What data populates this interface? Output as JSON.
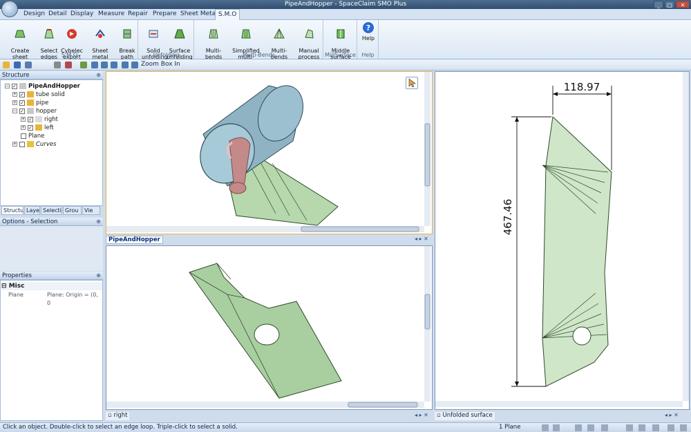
{
  "window": {
    "title": "PipeAndHopper - SpaceClaim SMO Plus",
    "minimize": "_",
    "maximize": "□",
    "close": "✕"
  },
  "tabs": [
    "Design",
    "Detail",
    "Display",
    "Measure",
    "Repair",
    "Prepare",
    "Sheet Metal",
    "S.M.O"
  ],
  "ribbon": {
    "groups": [
      {
        "label": "S.M.O",
        "buttons": [
          "Create sheet\nmetal profil",
          "Select\nedges",
          "Cybelec\nexport",
          "Sheet metal\nrebuild",
          "Break\npath"
        ]
      },
      {
        "label": "Unfolding",
        "buttons": [
          "Solid\nunfolding",
          "Surface\nunfolding"
        ]
      },
      {
        "label": "Multi-Bends",
        "buttons": [
          "Multi-bends",
          "Simplified\nmulti-bends",
          "Multi-bends\ncone",
          "Manual\nprocess"
        ]
      },
      {
        "label": "MidSurface",
        "buttons": [
          "Middle\nsurface"
        ]
      },
      {
        "label": "Help",
        "buttons": [
          "Help"
        ]
      }
    ]
  },
  "qat": {
    "zoom_label": "Zoom Box In"
  },
  "structure": {
    "title": "Structure",
    "items": [
      {
        "label": "PipeAndHopper",
        "level": 0,
        "expander": "−",
        "checked": true,
        "bold": true
      },
      {
        "label": "tube solid",
        "level": 1,
        "expander": "+",
        "checked": true
      },
      {
        "label": "pipe",
        "level": 1,
        "expander": "+",
        "checked": true
      },
      {
        "label": "hopper",
        "level": 1,
        "expander": "−",
        "checked": true
      },
      {
        "label": "right",
        "level": 2,
        "expander": "+",
        "checked": true
      },
      {
        "label": "left",
        "level": 2,
        "expander": "+",
        "checked": true
      },
      {
        "label": "Plane",
        "level": 1,
        "expander": "",
        "checked": false
      },
      {
        "label": "Curves",
        "level": 1,
        "expander": "+",
        "checked": false,
        "italic": true
      }
    ],
    "bottom_tabs": [
      "Structu",
      "Laye",
      "Selecti",
      "Grou",
      "Vie"
    ]
  },
  "options": {
    "title": "Options - Selection"
  },
  "properties": {
    "title": "Properties",
    "category": "Misc",
    "row_name": "Plane",
    "row_value": "Plane: Origin = (0, 0"
  },
  "viewports": {
    "doc_tab": "PipeAndHopper",
    "view2_tab": "right",
    "view3_tab": "Unfolded surface",
    "dimension_width": "118.97",
    "dimension_height": "467.46"
  },
  "status": {
    "message": "Click an object. Double-click to select an edge loop. Triple-click to select a solid.",
    "selection": "1 Plane"
  },
  "colors": {
    "accent": "#f0b040",
    "face": "#a9cfa0",
    "edge": "#2e4a2a",
    "pipe": "#8fb3c2",
    "elbow": "#c48a8a"
  }
}
